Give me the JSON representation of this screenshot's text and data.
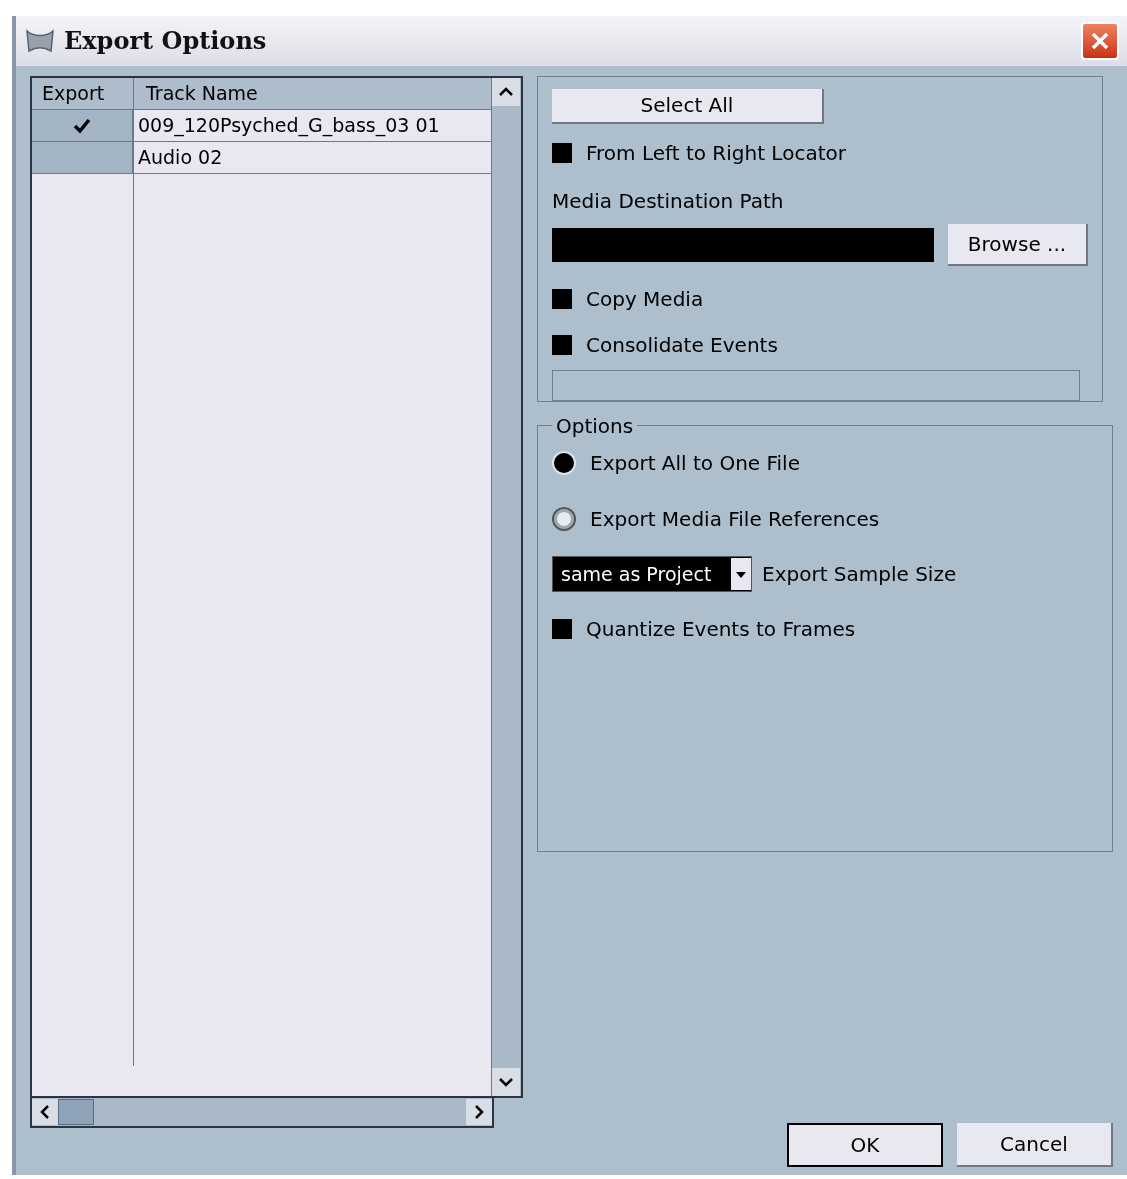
{
  "window": {
    "title": "Export Options"
  },
  "track_table": {
    "columns": [
      "Export",
      "Track Name"
    ],
    "rows": [
      {
        "export": true,
        "name": "009_120Psyched_G_bass_03 01"
      },
      {
        "export": false,
        "name": "Audio 02"
      }
    ]
  },
  "select_all_button": "Select All",
  "from_left_to_right": {
    "label": "From Left to Right Locator",
    "checked": false
  },
  "media_destination": {
    "label": "Media Destination Path",
    "browse": "Browse ..."
  },
  "copy_media": {
    "label": "Copy Media",
    "checked": false
  },
  "consolidate_events": {
    "label": "Consolidate Events",
    "checked": false
  },
  "options": {
    "title": "Options",
    "radios": [
      {
        "label": "Export All to One File",
        "selected": true
      },
      {
        "label": "Export Media File References",
        "selected": false
      }
    ],
    "sample_size": {
      "value": "same as Project",
      "label": "Export Sample Size"
    },
    "quantize": {
      "label": "Quantize Events to Frames",
      "checked": false
    }
  },
  "buttons": [
    "OK",
    "Cancel"
  ]
}
